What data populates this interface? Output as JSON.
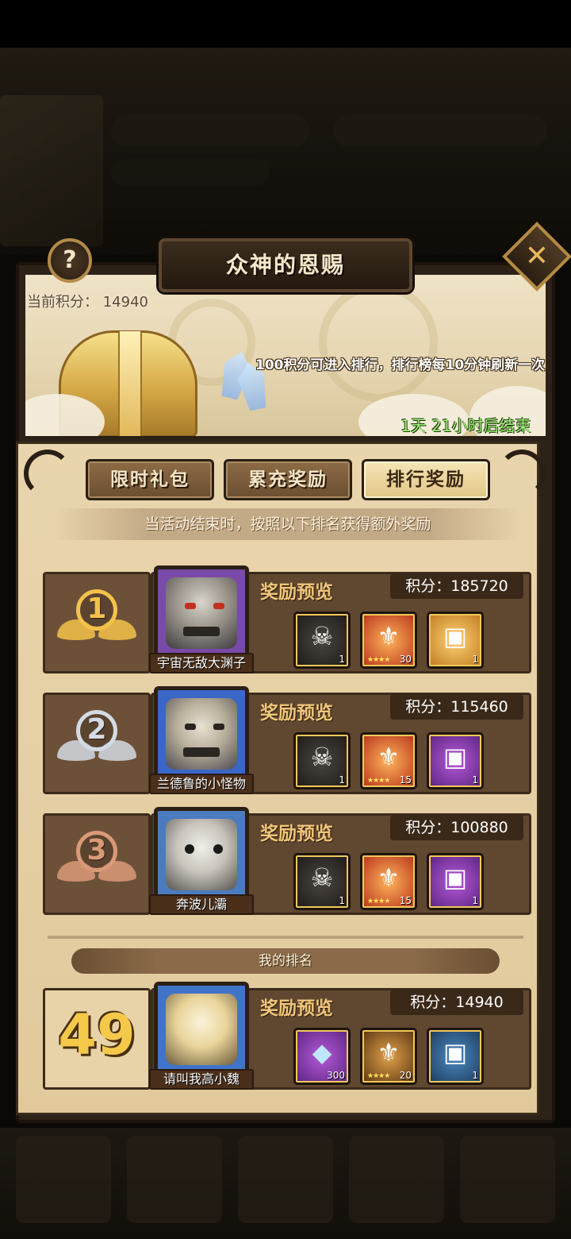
{
  "header": {
    "title": "众神的恩赐",
    "current_score_label": "当前积分：",
    "current_score": "14940",
    "notice": "100积分可进入排行，排行榜每10分钟刷新一次",
    "countdown": "1天 21小时后结束",
    "help_glyph": "?",
    "close_glyph": "✕"
  },
  "tabs": [
    "限时礼包",
    "累充奖励",
    "排行奖励"
  ],
  "active_tab": "排行奖励",
  "tip": "当活动结束时，按照以下排名获得额外奖励",
  "labels": {
    "preview": "奖励预览",
    "score": "积分：",
    "my_rank": "我的排名",
    "stars": "★★★★"
  },
  "icons": {
    "hero": "☠",
    "equip": "⚜",
    "chest": "▣",
    "gem": "◆"
  },
  "ranks": [
    {
      "rank": "1",
      "name": "宇宙无敌大渊子",
      "score": "185720",
      "items": [
        "1",
        "30",
        "1"
      ]
    },
    {
      "rank": "2",
      "name": "兰德鲁的小怪物",
      "score": "115460",
      "items": [
        "1",
        "15",
        "1"
      ]
    },
    {
      "rank": "3",
      "name": "奔波儿灞",
      "score": "100880",
      "items": [
        "1",
        "15",
        "1"
      ]
    }
  ],
  "mine": {
    "rank": "49",
    "name": "请叫我高小魏",
    "score": "14940",
    "items": [
      "300",
      "20",
      "1"
    ]
  },
  "colors": {
    "gold": "#f3c24a",
    "silver": "#d4dbe4",
    "bronze": "#d99a78",
    "countdown": "#9ef07a",
    "preview": "#f0c67a"
  }
}
